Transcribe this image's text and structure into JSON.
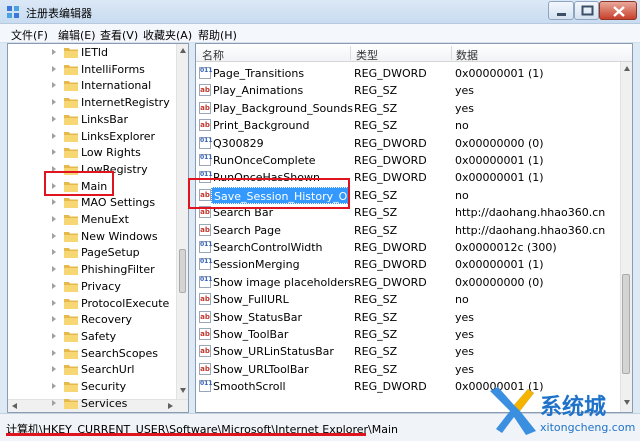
{
  "window": {
    "title": "注册表编辑器"
  },
  "menu": [
    "文件(F)",
    "编辑(E)",
    "查看(V)",
    "收藏夹(A)",
    "帮助(H)"
  ],
  "tree": {
    "items": [
      "IETld",
      "IntelliForms",
      "International",
      "InternetRegistry",
      "LinksBar",
      "LinksExplorer",
      "Low Rights",
      "LowRegistry",
      "Main",
      "MAO Settings",
      "MenuExt",
      "New Windows",
      "PageSetup",
      "PhishingFilter",
      "Privacy",
      "ProtocolExecute",
      "Recovery",
      "Safety",
      "SearchScopes",
      "SearchUrl",
      "Security",
      "Services"
    ],
    "selected": "Main"
  },
  "list": {
    "columns": {
      "name": "名称",
      "type": "类型",
      "data": "数据"
    },
    "rows": [
      {
        "icon": "dword",
        "name": "Page_Transitions",
        "type": "REG_DWORD",
        "data": "0x00000001 (1)"
      },
      {
        "icon": "sz",
        "name": "Play_Animations",
        "type": "REG_SZ",
        "data": "yes"
      },
      {
        "icon": "sz",
        "name": "Play_Background_Sounds",
        "type": "REG_SZ",
        "data": "yes"
      },
      {
        "icon": "sz",
        "name": "Print_Background",
        "type": "REG_SZ",
        "data": "no"
      },
      {
        "icon": "dword",
        "name": "Q300829",
        "type": "REG_DWORD",
        "data": "0x00000000 (0)"
      },
      {
        "icon": "dword",
        "name": "RunOnceComplete",
        "type": "REG_DWORD",
        "data": "0x00000001 (1)"
      },
      {
        "icon": "dword",
        "name": "RunOnceHasShown",
        "type": "REG_DWORD",
        "data": "0x00000001 (1)"
      },
      {
        "icon": "sz",
        "name": "Save_Session_History_On_...",
        "type": "REG_SZ",
        "data": "no"
      },
      {
        "icon": "sz",
        "name": "Search Bar",
        "type": "REG_SZ",
        "data": "http://daohang.hhao360.cn"
      },
      {
        "icon": "sz",
        "name": "Search Page",
        "type": "REG_SZ",
        "data": "http://daohang.hhao360.cn"
      },
      {
        "icon": "dword",
        "name": "SearchControlWidth",
        "type": "REG_DWORD",
        "data": "0x0000012c (300)"
      },
      {
        "icon": "dword",
        "name": "SessionMerging",
        "type": "REG_DWORD",
        "data": "0x00000001 (1)"
      },
      {
        "icon": "dword",
        "name": "Show image placeholders",
        "type": "REG_DWORD",
        "data": "0x00000000 (0)"
      },
      {
        "icon": "sz",
        "name": "Show_FullURL",
        "type": "REG_SZ",
        "data": "no"
      },
      {
        "icon": "sz",
        "name": "Show_StatusBar",
        "type": "REG_SZ",
        "data": "yes"
      },
      {
        "icon": "sz",
        "name": "Show_ToolBar",
        "type": "REG_SZ",
        "data": "yes"
      },
      {
        "icon": "sz",
        "name": "Show_URLinStatusBar",
        "type": "REG_SZ",
        "data": "yes"
      },
      {
        "icon": "sz",
        "name": "Show_URLToolBar",
        "type": "REG_SZ",
        "data": "yes"
      },
      {
        "icon": "dword",
        "name": "SmoothScroll",
        "type": "REG_DWORD",
        "data": "0x00000001 (1)"
      }
    ],
    "selected": "Save_Session_History_On_..."
  },
  "status": {
    "path": "计算机\\HKEY_CURRENT_USER\\Software\\Microsoft\\Internet Explorer\\Main"
  },
  "watermark": {
    "text": "系统城",
    "url": "xitongcheng.com"
  },
  "colors": {
    "highlight": "#e0141e",
    "selection": "#3399ff",
    "watermark": "#1e73c9"
  }
}
